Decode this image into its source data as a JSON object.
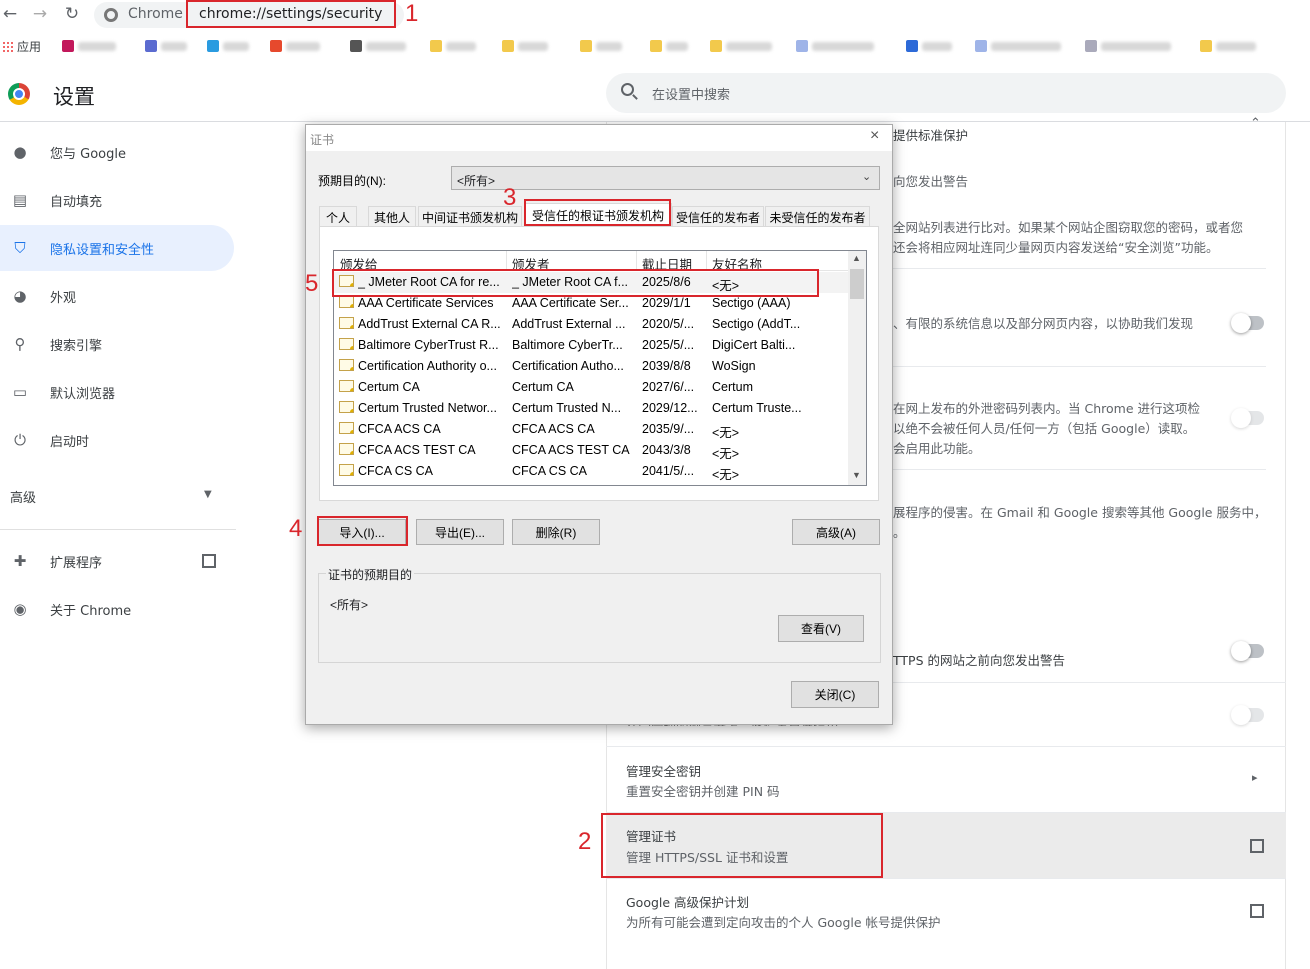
{
  "browser": {
    "omnibox_scheme": "Chrome",
    "url": "chrome://settings/security",
    "apps_label": "应用"
  },
  "settings": {
    "title": "设置",
    "search_placeholder": "在设置中搜索",
    "sidebar": [
      {
        "label": "您与 Google",
        "icon": "person-icon"
      },
      {
        "label": "自动填充",
        "icon": "clipboard-icon"
      },
      {
        "label": "隐私设置和安全性",
        "icon": "shield-icon",
        "active": true
      },
      {
        "label": "外观",
        "icon": "palette-icon"
      },
      {
        "label": "搜索引擎",
        "icon": "search-icon"
      },
      {
        "label": "默认浏览器",
        "icon": "browser-icon"
      },
      {
        "label": "启动时",
        "icon": "power-icon"
      }
    ],
    "advanced_label": "高级",
    "extensions_label": "扩展程序",
    "about_label": "关于 Chrome"
  },
  "main": {
    "t1": "提供标准保护",
    "t2": "向您发出警告",
    "t3a": "全网站列表进行比对。如果某个网站企图窃取您的密码，或者您",
    "t3b": "还会将相应网址连同少量网页内容发送给“安全浏览”功能。",
    "t4": "、有限的系统信息以及部分网页内容，以协助我们发现",
    "t5a": "在网上发布的外泄密码列表内。当 Chrome 进行这项检",
    "t5b": "以绝不会被任何人员/任何一方（包括 Google）读取。",
    "t5c": "会启用此功能。",
    "t6a": "展程序的侵害。在 Gmail 和 Google 搜索等其他 Google 服务中，",
    "t6b": "。",
    "t7": "TTPS 的网站之前向您发出警告",
    "t8": "在受管理的浏览器上，此设置已被停用",
    "keys_title": "管理安全密钥",
    "keys_sub": "重置安全密钥并创建 PIN 码",
    "certs_title": "管理证书",
    "certs_sub": "管理 HTTPS/SSL 证书和设置",
    "gap_title": "Google 高级保护计划",
    "gap_sub": "为所有可能会遭到定向攻击的个人 Google 帐号提供保护"
  },
  "dialog": {
    "title": "证书",
    "purpose_label": "预期目的(N):",
    "purpose_value": "<所有>",
    "tabs": [
      "个人",
      "其他人",
      "中间证书颁发机构",
      "受信任的根证书颁发机构",
      "受信任的发布者",
      "未受信任的发布者"
    ],
    "columns": [
      "颁发给",
      "颁发者",
      "截止日期",
      "友好名称"
    ],
    "rows": [
      [
        "_ JMeter Root CA for re...",
        "_ JMeter Root CA f...",
        "2025/8/6",
        "<无>"
      ],
      [
        "AAA Certificate Services",
        "AAA Certificate Ser...",
        "2029/1/1",
        "Sectigo (AAA)"
      ],
      [
        "AddTrust External CA R...",
        "AddTrust External ...",
        "2020/5/...",
        "Sectigo (AddT..."
      ],
      [
        "Baltimore CyberTrust R...",
        "Baltimore CyberTr...",
        "2025/5/...",
        "DigiCert Balti..."
      ],
      [
        "Certification Authority o...",
        "Certification Autho...",
        "2039/8/8",
        "WoSign"
      ],
      [
        "Certum CA",
        "Certum CA",
        "2027/6/...",
        "Certum"
      ],
      [
        "Certum Trusted Networ...",
        "Certum Trusted N...",
        "2029/12...",
        "Certum Truste..."
      ],
      [
        "CFCA ACS CA",
        "CFCA ACS CA",
        "2035/9/...",
        "<无>"
      ],
      [
        "CFCA ACS TEST CA",
        "CFCA ACS TEST CA",
        "2043/3/8",
        "<无>"
      ],
      [
        "CFCA CS CA",
        "CFCA CS CA",
        "2041/5/...",
        "<无>"
      ]
    ],
    "import_label": "导入(I)...",
    "export_label": "导出(E)...",
    "delete_label": "删除(R)",
    "advanced_label": "高级(A)",
    "purposes_group": "证书的预期目的",
    "purposes_value": "<所有>",
    "view_label": "查看(V)",
    "close_label": "关闭(C)"
  },
  "annotations": [
    "1",
    "2",
    "3",
    "4",
    "5"
  ],
  "colors": {
    "annotation_red": "#d9262c",
    "accent": "#1a73e8"
  }
}
